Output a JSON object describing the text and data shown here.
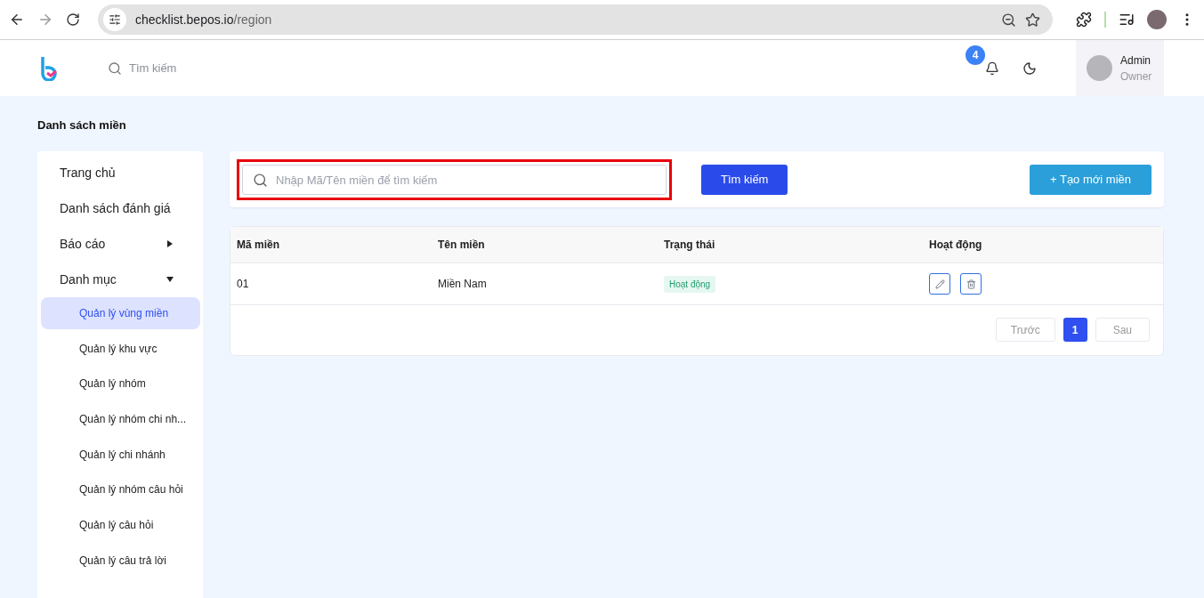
{
  "browser": {
    "url_host": "checklist.bepos.io",
    "url_path": "/region"
  },
  "header": {
    "search_placeholder": "Tìm kiếm",
    "notification_count": "4",
    "user": {
      "name": "Admin",
      "role": "Owner"
    }
  },
  "page_title": "Danh sách miền",
  "sidebar": {
    "items": [
      {
        "kind": "link",
        "label": "Trang chủ"
      },
      {
        "kind": "link",
        "label": "Danh sách đánh giá"
      },
      {
        "kind": "group",
        "label": "Báo cáo",
        "expanded": false
      },
      {
        "kind": "group",
        "label": "Danh mục",
        "expanded": true,
        "children": [
          {
            "label": "Quản lý vùng miền",
            "selected": true
          },
          {
            "label": "Quản lý khu vực",
            "selected": false
          },
          {
            "label": "Quản lý nhóm",
            "selected": false
          },
          {
            "label": "Quản lý nhóm chi nh...",
            "selected": false
          },
          {
            "label": "Quản lý chi nhánh",
            "selected": false
          },
          {
            "label": "Quản lý nhóm câu hỏi",
            "selected": false
          },
          {
            "label": "Quản lý câu hỏi",
            "selected": false
          },
          {
            "label": "Quản lý câu trả lời",
            "selected": false
          }
        ]
      }
    ]
  },
  "toolbar": {
    "search": {
      "placeholder": "Nhập Mã/Tên miền để tìm kiếm",
      "highlighted": true
    },
    "search_button": "Tìm kiếm",
    "create_button": "+ Tạo mới miền"
  },
  "table": {
    "columns": [
      "Mã miền",
      "Tên miền",
      "Trạng thái",
      "Hoạt động"
    ],
    "rows": [
      {
        "code": "01",
        "name": "Miền Nam",
        "status": "Hoạt động"
      }
    ]
  },
  "pagination": {
    "previous": "Trước",
    "pages": [
      {
        "label": "1",
        "selected": true
      }
    ],
    "next": "Sau"
  }
}
